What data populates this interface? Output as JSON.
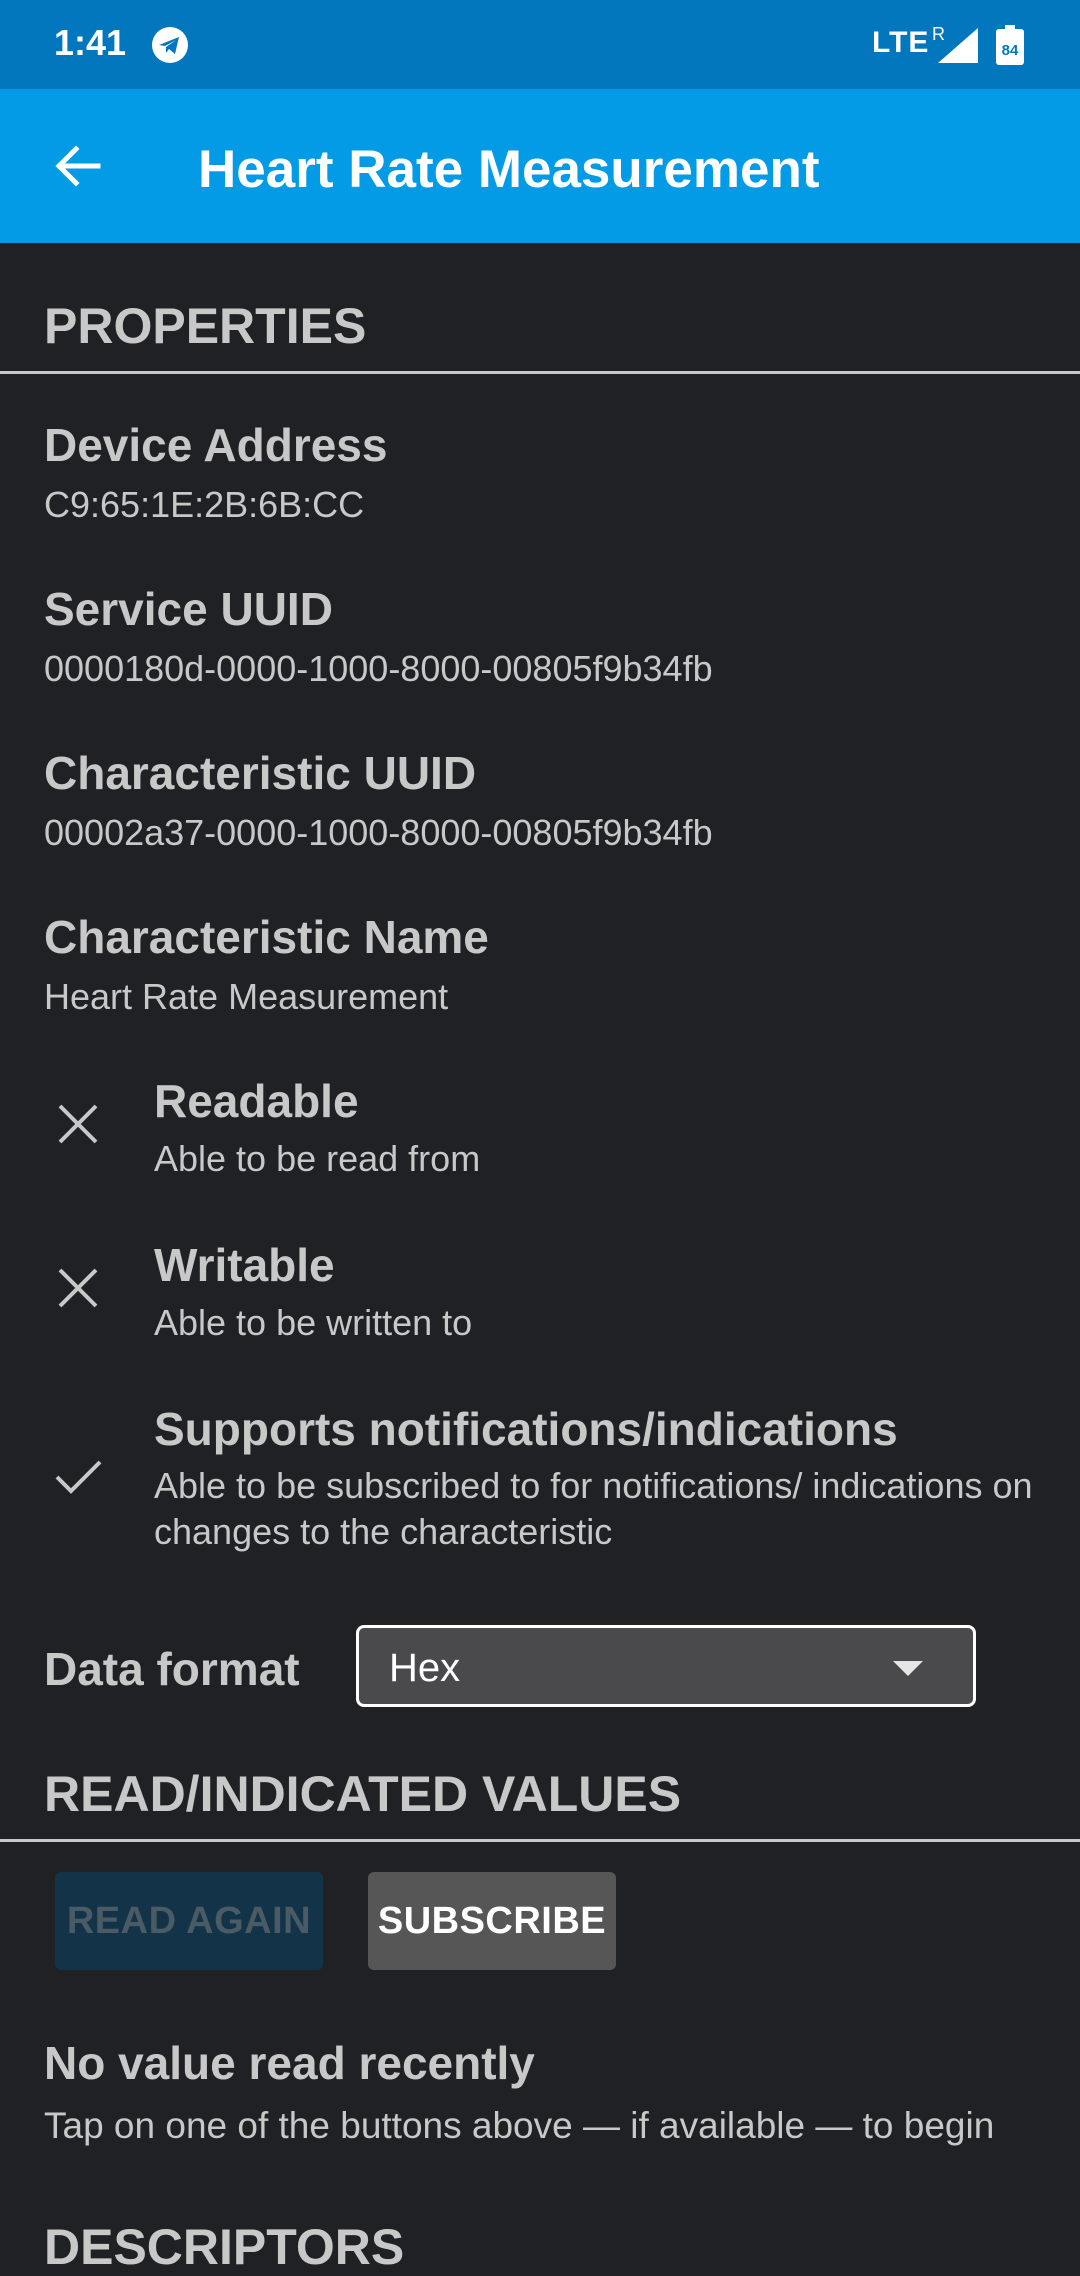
{
  "status_bar": {
    "time": "1:41",
    "network": "LTE",
    "roaming": "R",
    "battery": "84"
  },
  "app_bar": {
    "title": "Heart Rate Measurement",
    "back_icon": "arrow-left-icon"
  },
  "properties": {
    "header": "PROPERTIES",
    "items": [
      {
        "label": "Device Address",
        "value": "C9:65:1E:2B:6B:CC"
      },
      {
        "label": "Service UUID",
        "value": "0000180d-0000-1000-8000-00805f9b34fb"
      },
      {
        "label": "Characteristic UUID",
        "value": "00002a37-0000-1000-8000-00805f9b34fb"
      },
      {
        "label": "Characteristic Name",
        "value": "Heart Rate Measurement"
      }
    ],
    "capabilities": [
      {
        "title": "Readable",
        "desc": "Able to be read from",
        "icon": "close-icon",
        "supported": false
      },
      {
        "title": "Writable",
        "desc": "Able to be written to",
        "icon": "close-icon",
        "supported": false
      },
      {
        "title": "Supports notifications/indications",
        "desc": "Able to be subscribed to for notifications/ indications on changes to the characteristic",
        "icon": "check-icon",
        "supported": true
      }
    ]
  },
  "data_format": {
    "label": "Data format",
    "selected": "Hex"
  },
  "values_section": {
    "header": "READ/INDICATED VALUES",
    "read_again_label": "READ AGAIN",
    "subscribe_label": "SUBSCRIBE",
    "empty_title": "No value read recently",
    "empty_desc": "Tap on one of the buttons above — if available — to begin"
  },
  "descriptors_header": "DESCRIPTORS",
  "colors": {
    "status_bar": "#0277bd",
    "app_bar": "#039be5",
    "background": "#202124",
    "text": "#c8c8c8"
  }
}
